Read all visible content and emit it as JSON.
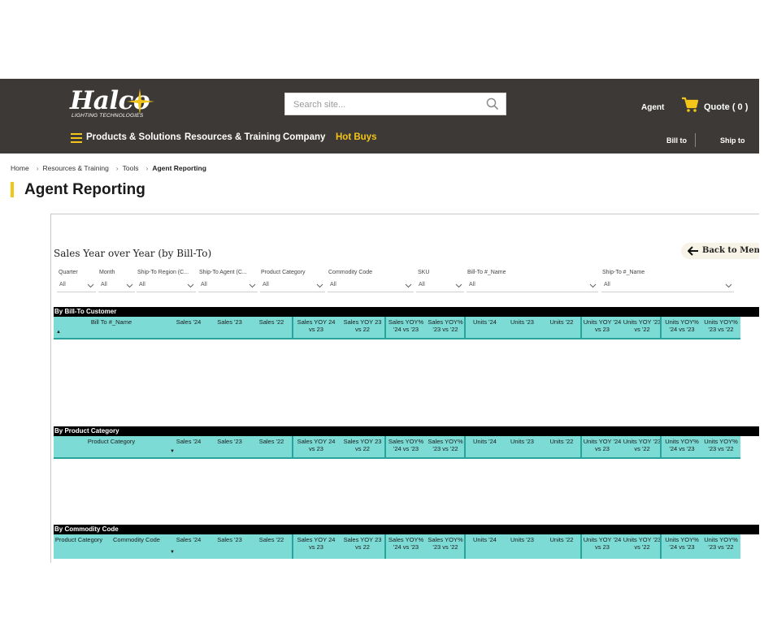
{
  "header": {
    "logo_text": "Halco",
    "logo_tagline": "LIGHTING TECHNOLOGIES",
    "search_placeholder": "Search site...",
    "agent": "Agent",
    "quote": "Quote ( 0 )",
    "nav": [
      "Products & Solutions",
      "Resources & Training",
      "Company",
      "Hot Buys"
    ],
    "bill_to": "Bill to",
    "ship_to": "Ship to",
    "hot_color": "#f3c518"
  },
  "breadcrumb": [
    "Home",
    "Resources & Training",
    "Tools",
    "Agent Reporting"
  ],
  "page_title": "Agent Reporting",
  "report": {
    "title": "Sales Year over Year (by Bill-To)",
    "back_button": "Back to Menu",
    "filters": [
      {
        "label": "Quarter",
        "value": "All"
      },
      {
        "label": "Month",
        "value": "All"
      },
      {
        "label": "Ship-To Region (C...",
        "value": "All"
      },
      {
        "label": "Ship-To Agent (C...",
        "value": "All"
      },
      {
        "label": "Product Category",
        "value": "All"
      },
      {
        "label": "Commodity Code",
        "value": "All"
      },
      {
        "label": "SKU",
        "value": "All"
      },
      {
        "label": "Bill-To #_Name",
        "value": "All"
      },
      {
        "label": "Ship-To #_Name",
        "value": "All"
      }
    ],
    "sections": [
      {
        "title": "By Bill-To Customer",
        "columns": [
          "Bill To #_Name",
          "Sales '24",
          "Sales '23",
          "Sales '22",
          "Sales YOY 24 vs 23",
          "Sales YOY 23 vs 22",
          "Sales YOY% '24 vs '23",
          "Sales YOY% '23 vs '22",
          "Units '24",
          "Units '23",
          "Units '22",
          "Units YOY '24 vs 23",
          "Units YOY '23 vs '22",
          "Units YOY% '24 vs '23",
          "Units YOY% '23 vs '22"
        ],
        "sort_glyph": "▲"
      },
      {
        "title": "By Product Category",
        "columns": [
          "Product Category",
          "Sales '24",
          "Sales '23",
          "Sales '22",
          "Sales YOY 24 vs 23",
          "Sales YOY 23 vs 22",
          "Sales YOY% '24 vs '23",
          "Sales YOY% '23 vs '22",
          "Units '24",
          "Units '23",
          "Units '22",
          "Units YOY '24 vs 23",
          "Units YOY '23 vs '22",
          "Units YOY% '24 vs '23",
          "Units YOY% '23 vs '22"
        ],
        "sort_glyph": "▼"
      },
      {
        "title": "By Commodity Code",
        "columns": [
          "Product Category",
          "Commodity Code",
          "Sales '24",
          "Sales '23",
          "Sales '22",
          "Sales YOY 24 vs 23",
          "Sales YOY 23 vs 22",
          "Sales YOY% '24 vs '23",
          "Sales YOY% '23 vs '22",
          "Units '24",
          "Units '23",
          "Units '22",
          "Units YOY '24 vs 23",
          "Units YOY '23 vs '22",
          "Units YOY% '24 vs '23",
          "Units YOY% '23 vs '22"
        ],
        "sort_glyph": "▼"
      }
    ],
    "header_color": "#7ddbd6"
  }
}
